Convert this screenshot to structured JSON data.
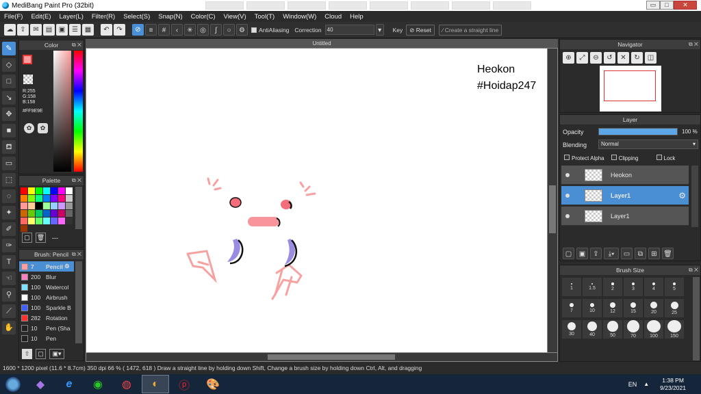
{
  "window": {
    "title": "MediBang Paint Pro (32bit)",
    "min": "▭",
    "max": "□",
    "close": "✕"
  },
  "menu": [
    "File(F)",
    "Edit(E)",
    "Layer(L)",
    "Filter(R)",
    "Select(S)",
    "Snap(N)",
    "Color(C)",
    "View(V)",
    "Tool(T)",
    "Window(W)",
    "Cloud",
    "Help"
  ],
  "toolbar": {
    "antialiasing": "AntiAliasing",
    "correction_label": "Correction",
    "correction_value": "40",
    "key_label": "Key",
    "reset_label": "Reset",
    "straight_line": "Create a straight line"
  },
  "color_panel": {
    "title": "Color",
    "r": "R:255",
    "g": "G:158",
    "b": "B:158",
    "hex": "#FF9E9E",
    "foreground": "#ff9e9e"
  },
  "palette_panel": {
    "title": "Palette",
    "more": "---",
    "swatches": [
      "#ff0000",
      "#ffff00",
      "#00ff00",
      "#00ffff",
      "#0000ff",
      "#ff00ff",
      "#ffffff",
      "#ff8000",
      "#80ff00",
      "#00ff80",
      "#0080ff",
      "#8000ff",
      "#ff0080",
      "#cccccc",
      "#ff9999",
      "#ffcc99",
      "#000000",
      "#99ff99",
      "#99ccff",
      "#cc99ff",
      "#999999",
      "#cc6600",
      "#66cc00",
      "#00cc66",
      "#0066cc",
      "#6600cc",
      "#cc0066",
      "#666666",
      "#ff6666",
      "#ffff66",
      "#66ff66",
      "#66ffff",
      "#6666ff",
      "#ff66ff",
      "#333333",
      "#993300"
    ]
  },
  "brush_panel": {
    "title": "Brush: Pencil",
    "brushes": [
      {
        "size": "7",
        "name": "Pencil",
        "color": "#ff9e9e",
        "selected": true
      },
      {
        "size": "200",
        "name": "Blur",
        "color": "#ff80c0",
        "selected": false
      },
      {
        "size": "100",
        "name": "Watercol",
        "color": "#80e0ff",
        "selected": false
      },
      {
        "size": "100",
        "name": "Airbrush",
        "color": "#ffffff",
        "selected": false
      },
      {
        "size": "100",
        "name": "Sparkle B",
        "color": "#4060ff",
        "selected": false
      },
      {
        "size": "282",
        "name": "Rotation",
        "color": "#ff3030",
        "selected": false
      },
      {
        "size": "10",
        "name": "Pen (Sha",
        "color": "#222222",
        "selected": false
      },
      {
        "size": "10",
        "name": "Pen",
        "color": "#222222",
        "selected": false
      }
    ]
  },
  "document": {
    "tab": "Untitled",
    "text_line1": "Heokon",
    "text_line2": "#Hoidap247"
  },
  "navigator": {
    "title": "Navigator"
  },
  "layer_panel": {
    "title": "Layer",
    "opacity_label": "Opacity",
    "opacity_value": "100 %",
    "opacity_fraction": 1.0,
    "blending_label": "Blending",
    "blending_value": "Normal",
    "protect_alpha": "Protect Alpha",
    "clipping": "Clipping",
    "lock": "Lock",
    "layers": [
      {
        "name": "Heokon",
        "selected": false
      },
      {
        "name": "Layer1",
        "selected": true
      },
      {
        "name": "Layer1",
        "selected": false
      }
    ]
  },
  "brush_size": {
    "title": "Brush Size",
    "sizes": [
      "1",
      "1.5",
      "2",
      "3",
      "4",
      "5",
      "7",
      "10",
      "12",
      "15",
      "20",
      "25",
      "30",
      "40",
      "50",
      "70",
      "100",
      "150"
    ]
  },
  "status": {
    "text": "1600 * 1200 pixel   (11.6 * 8.7cm)   350 dpi   66 %   ( 1472, 618 )   Draw a straight line by holding down Shift, Change a brush size by holding down Ctrl, Alt, and dragging"
  },
  "taskbar": {
    "lang": "EN",
    "time": "1:38 PM",
    "date": "9/23/2021"
  }
}
